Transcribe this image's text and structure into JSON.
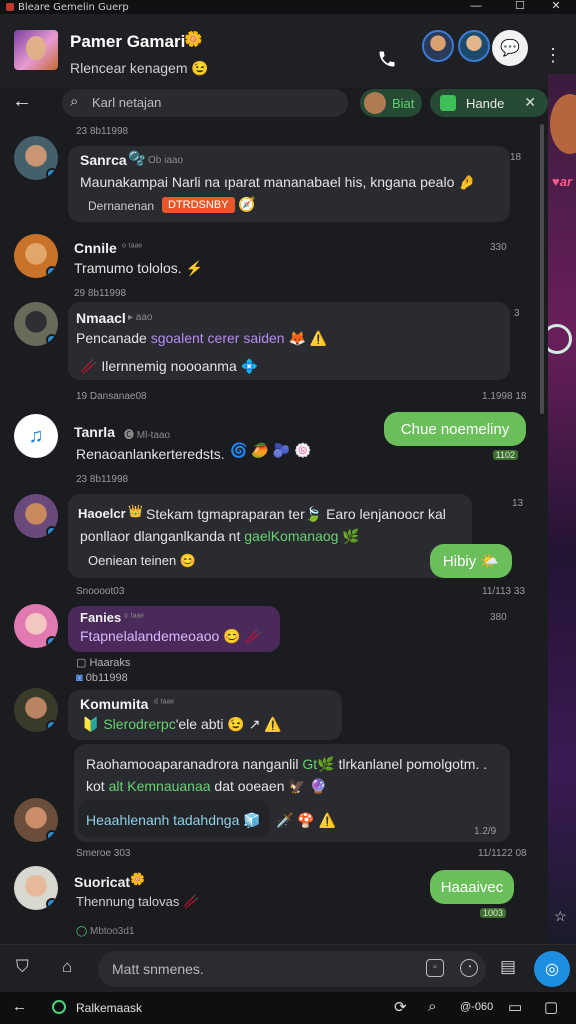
{
  "window": {
    "title": "Bleare Gemelin Guerp",
    "minimize": "—",
    "maximize": "☐",
    "close": "✕"
  },
  "header": {
    "group_name": "Pamer Gamari",
    "group_badge": "🌼",
    "subtitle": "Rlencear kenagem 😉",
    "call_icon": "phone-icon",
    "more_icon": "⋮"
  },
  "search": {
    "placeholder": "Karl netajan",
    "chip1_label": "Biat",
    "chip2_label": "Hande",
    "chip_close": "✕"
  },
  "messages": [
    {
      "date": "23 8b11998",
      "name": "Sanrca",
      "name_emoji": "🫧",
      "meta": "Ob iaao",
      "text": "Maunakampai Narli na ıparat mananabael his, kngana pealo 🤌",
      "sub_text": "Dernanenan",
      "tag": "DTRDSNBY",
      "right_time": "18"
    },
    {
      "name": "Cnnile",
      "meta": "ᵒ ᵗᵃᵃᵉ",
      "text": "Tramumo tololos. ⚡",
      "right_time": "330"
    },
    {
      "date": "29 8b11998",
      "name": "Nmaacl",
      "meta": "▸ aao",
      "text_prefix": "Pencanade ",
      "text_highlight": "sgoalent cerer saiden",
      "text_suffix": " 🦊 ⚠️",
      "sub_text": "🥢 Ilernnemig noooanma 💠",
      "right_time": "3",
      "date2": "19 Dansanae08",
      "right_time2": "1.1998 18"
    },
    {
      "name": "Tanrla",
      "meta": "🅒 Ml-taao",
      "text": "Renaoanlankerteredsts.",
      "reactions": "🌀 🥭 🫐 🍥",
      "green_text": "Chue noemeliny",
      "green_time": "1102"
    },
    {
      "date": "23 8b11998",
      "name": "Haoelcr",
      "name_emoji": "👑",
      "text_line1": "Stekam tgmapraparan ter🍃 Earo lenjanoocr kal",
      "text_line2_prefix": "ponllaor dlanganlkanda nt ",
      "text_line2_highlight": "gaelKomanaog",
      "text_line2_suffix": " 🌿",
      "sub_text": "Oeniean teinen 😊",
      "green_text": "Hibiy 🌤️",
      "right_time": "13",
      "footer": "Snoooot03",
      "footer_time": "11/113 33"
    },
    {
      "name": "Fanies",
      "meta": "ᵒ ᵗᵃᵃᵉ",
      "text": "Ftapnelalandemeoaoo 😊 🥢",
      "right_time": "380",
      "line1": "Haaraks",
      "line2": "0b11998"
    },
    {
      "name": "Komumita",
      "meta": "ᵈ ᵗᵃᵃᵉ",
      "text_prefix": "🔰 ",
      "text_highlight": "Slerodrerpc",
      "text_suffix": "'ele abti 😉 ↗ ⚠️"
    },
    {
      "text_line1_prefix": "Raohamooaparanadrora nanganlil ",
      "text_line1_highlight": "Gt🌿",
      "text_line1_suffix": " tlrkanlanel pomolgotm. .",
      "text_line2_prefix": "kot ",
      "text_line2_highlight": "alt Kemnauanaa",
      "text_line2_suffix": " dat ooeaen 🦅 🔮",
      "inner_text": "Heaahlenanh tadahdnga 🧊",
      "extras": "🗡️ 🍄 ⚠️",
      "right_time": "1.2/9",
      "footer": "Smeroe 303",
      "footer_time": "11/1122 08"
    },
    {
      "name": "Suoricat",
      "name_emoji": "🌼",
      "text": "Thennung talovas 🥢",
      "green_text": "Haaaivec",
      "green_time": "1003",
      "footer": "Mbtoo3d1"
    }
  ],
  "composer": {
    "placeholder": "Matt snmenes."
  },
  "taskbar": {
    "label": "Ralkemaask",
    "clock": "@-060"
  }
}
